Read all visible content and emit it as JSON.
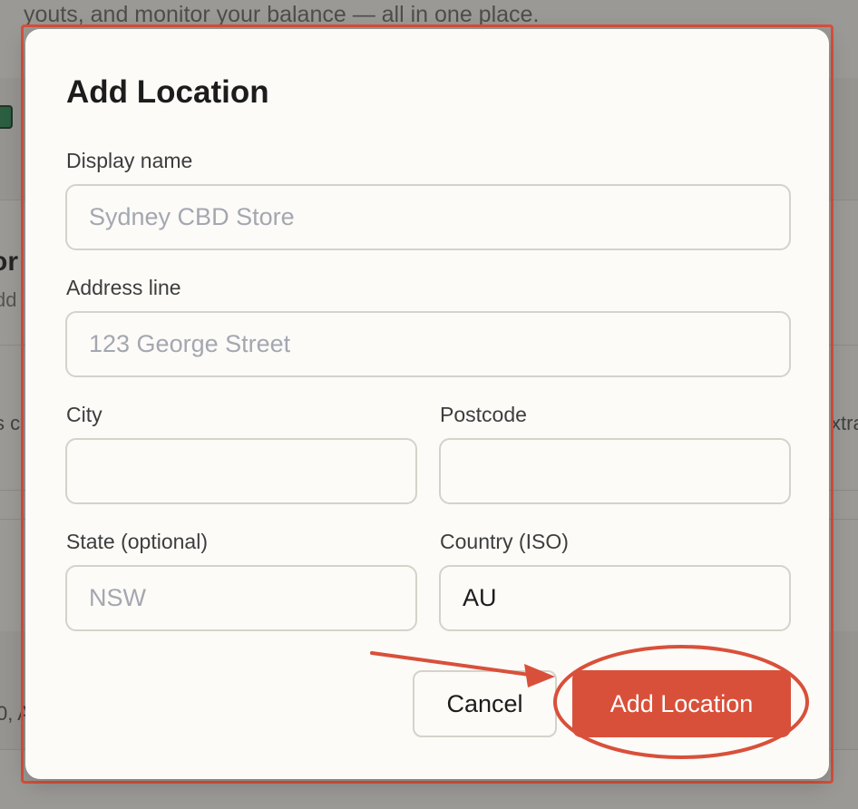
{
  "background": {
    "intro_text": "youts, and monitor your balance — all in one place.",
    "heading_fragment": "or",
    "sub_fragment": "dd",
    "left_fragment": "s c",
    "right_fragment": "xtra",
    "bottom_fragment": "0, A"
  },
  "modal": {
    "title": "Add Location",
    "fields": {
      "display_name": {
        "label": "Display name",
        "value": "",
        "placeholder": "Sydney CBD Store"
      },
      "address_line": {
        "label": "Address line",
        "value": "",
        "placeholder": "123 George Street"
      },
      "city": {
        "label": "City",
        "value": "",
        "placeholder": ""
      },
      "postcode": {
        "label": "Postcode",
        "value": "",
        "placeholder": ""
      },
      "state": {
        "label": "State (optional)",
        "value": "",
        "placeholder": "NSW"
      },
      "country": {
        "label": "Country (ISO)",
        "value": "AU",
        "placeholder": ""
      }
    },
    "buttons": {
      "cancel_label": "Cancel",
      "add_label": "Add Location"
    }
  },
  "colors": {
    "accent": "#d9503a",
    "annotation": "#d9503a"
  }
}
